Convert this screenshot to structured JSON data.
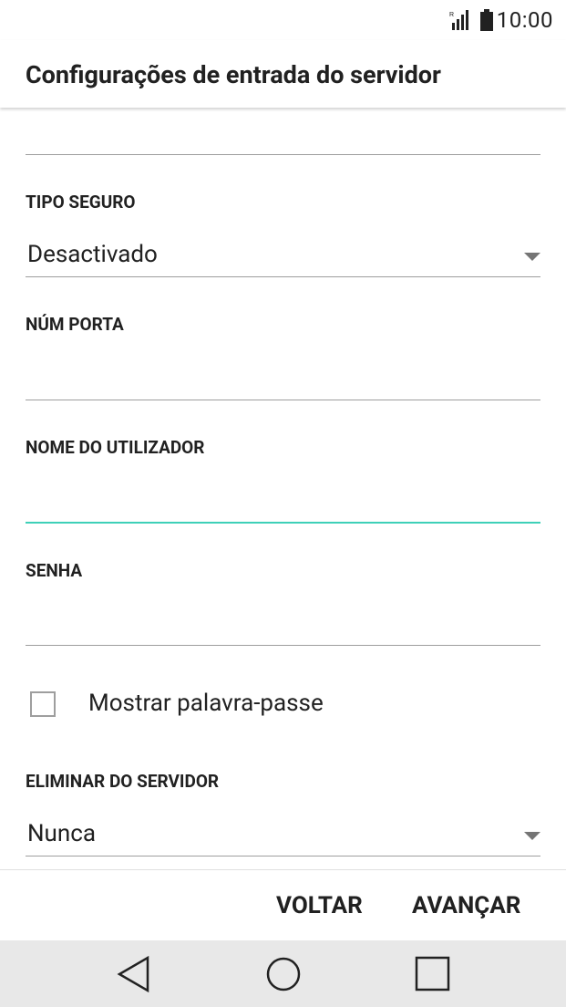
{
  "status_bar": {
    "time": "10:00",
    "signal_icon": "signal-icon",
    "battery_icon": "battery-icon"
  },
  "header": {
    "title": "Configurações de entrada do servidor"
  },
  "form": {
    "secure_type": {
      "label": "TIPO SEGURO",
      "value": "Desactivado"
    },
    "port": {
      "label": "NÚM PORTA",
      "value": ""
    },
    "username": {
      "label": "NOME DO UTILIZADOR",
      "value": ""
    },
    "password": {
      "label": "SENHA",
      "value": ""
    },
    "show_password": {
      "label": "Mostrar palavra-passe",
      "checked": false
    },
    "delete_from_server": {
      "label": "ELIMINAR DO SERVIDOR",
      "value": "Nunca"
    }
  },
  "actions": {
    "back_label": "VOLTAR",
    "next_label": "AVANÇAR"
  },
  "nav_bar": {
    "back_icon": "back-triangle-icon",
    "home_icon": "home-circle-icon",
    "recents_icon": "recents-square-icon"
  },
  "colors": {
    "accent": "#3ed0b8",
    "divider": "#9e9e9e",
    "nav_bg": "#e8e8e8"
  }
}
